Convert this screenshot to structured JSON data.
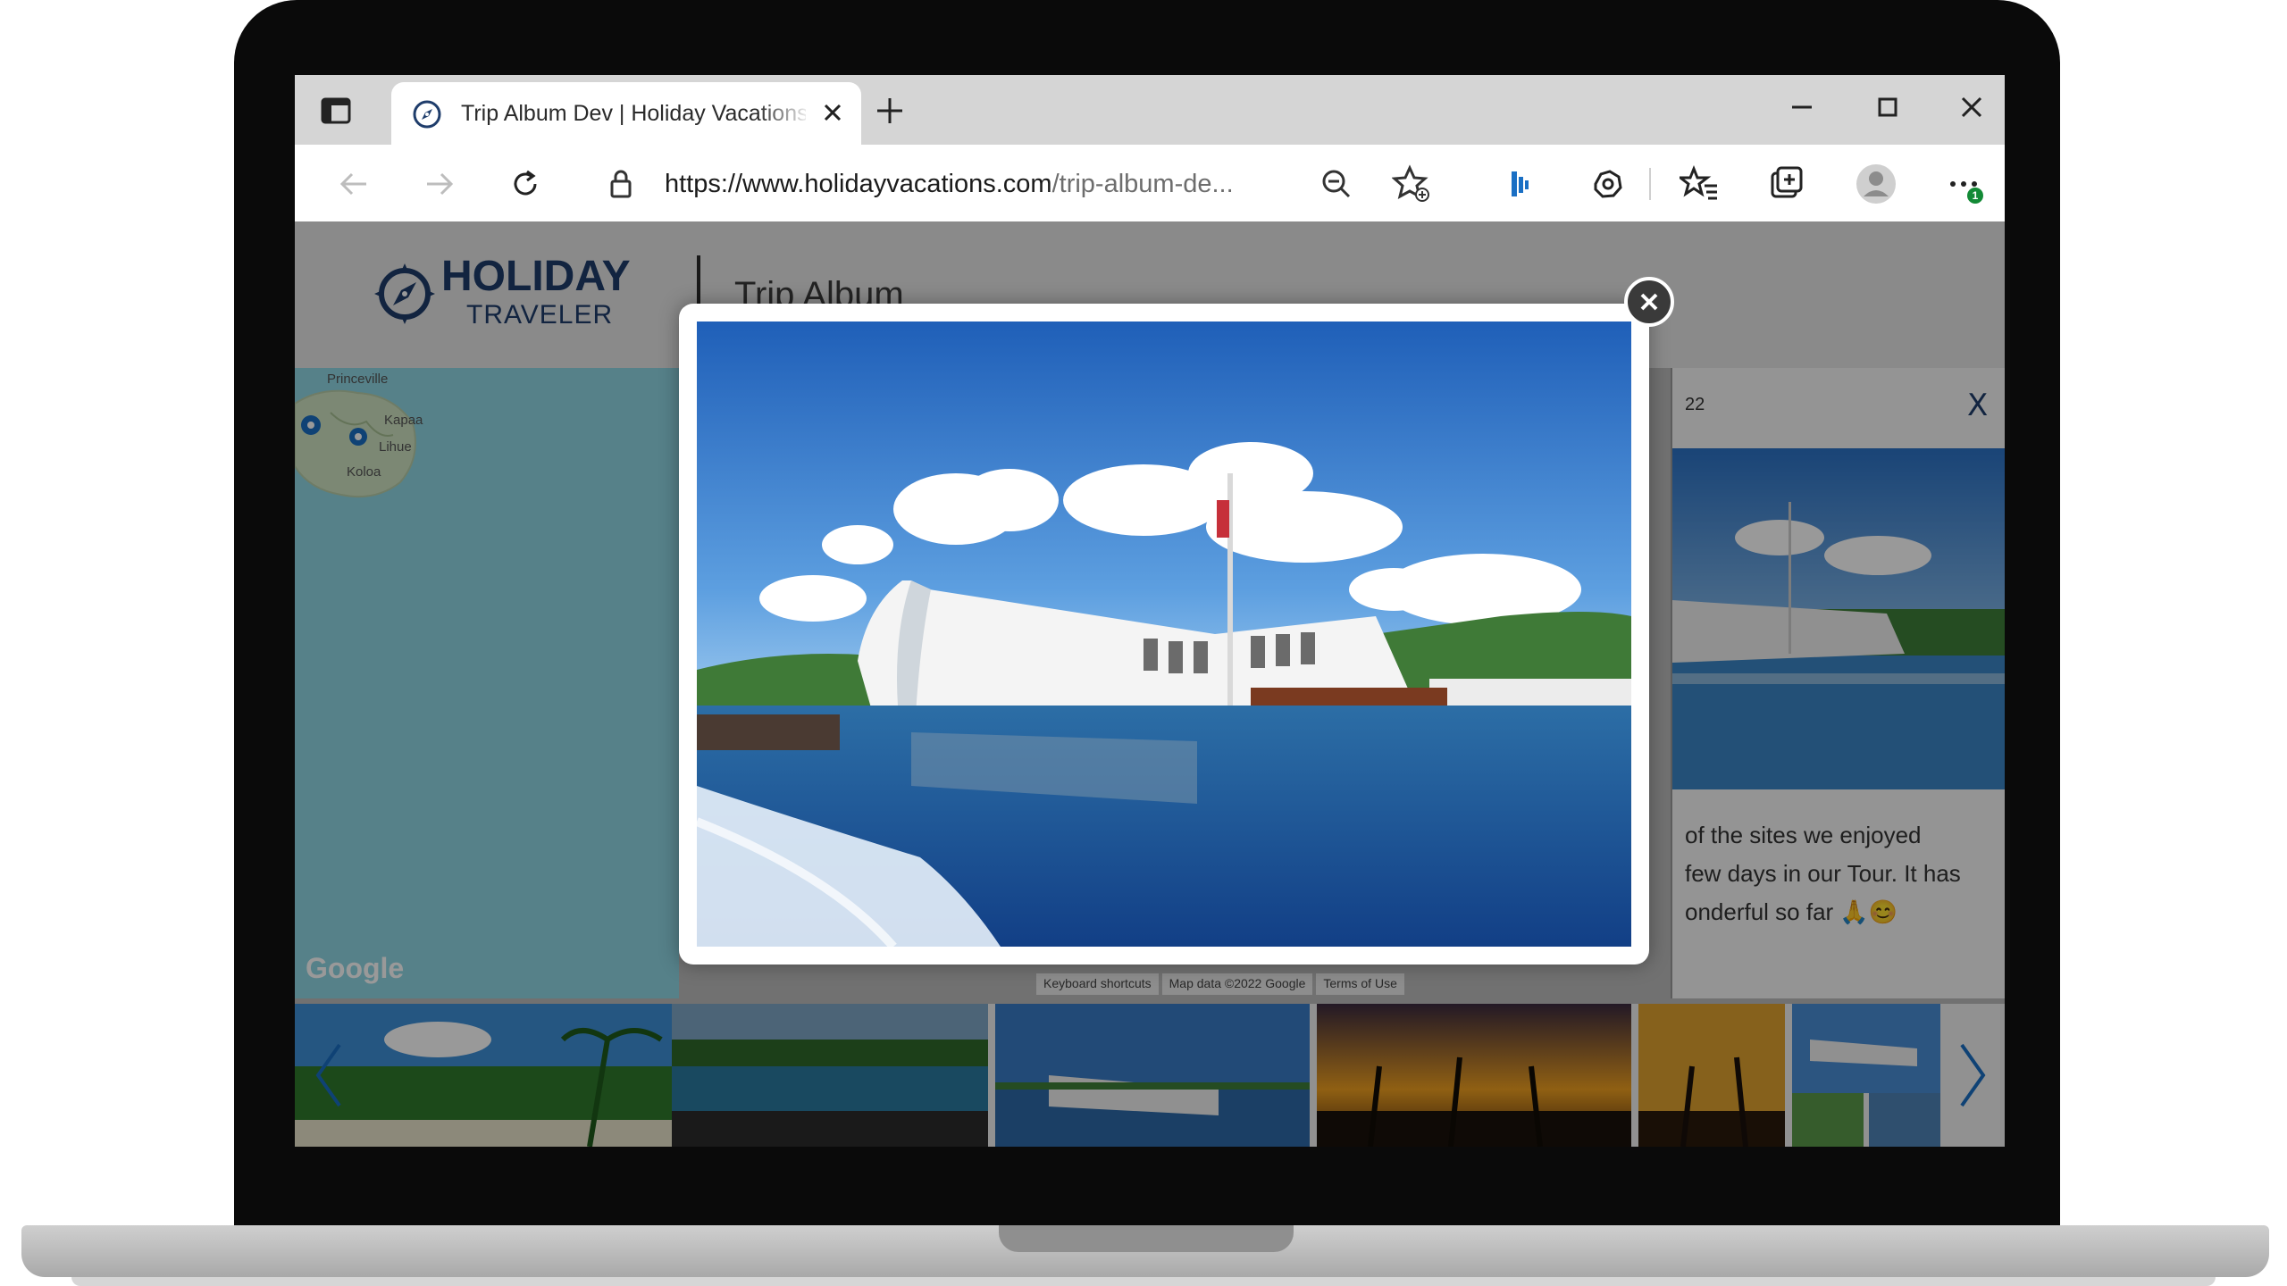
{
  "browser": {
    "tab": {
      "title": "Trip Album Dev | Holiday Vacations"
    },
    "address": {
      "scheme_host": "https://www.holidayvacations.com",
      "path": "/trip-album-de..."
    },
    "notification_count": "1"
  },
  "site": {
    "logo": {
      "line1": "HOLIDAY",
      "line2": "TRAVELER"
    },
    "page_title": "Trip Album"
  },
  "map": {
    "places": [
      "Princeville",
      "Kapaa",
      "Lihue",
      "Koloa"
    ],
    "provider": "Google",
    "attribution": [
      "Keyboard shortcuts",
      "Map data ©2022 Google",
      "Terms of Use"
    ]
  },
  "post": {
    "date": "22",
    "close_label": "X",
    "text_lines": [
      "of the sites we enjoyed",
      "few days in our Tour. It has",
      "onderful so far 🙏😊"
    ]
  },
  "filmstrip": {
    "thumbnails": [
      "tropical-beach",
      "rocky-cove",
      "arizona-memorial",
      "sunset-palms",
      "sunset-palms-2",
      "memorial-collage"
    ]
  },
  "icons": {
    "tab_actions": "tab-actions-icon",
    "favicon": "compass-icon",
    "close": "close-icon",
    "new_tab": "plus-icon",
    "back": "back-arrow-icon",
    "forward": "forward-arrow-icon",
    "refresh": "refresh-icon",
    "lock": "lock-icon",
    "zoom": "zoom-out-icon",
    "favorite": "add-favorite-icon",
    "extensions": "extensions-icon",
    "favorites": "favorites-icon",
    "collections": "collections-icon",
    "profile": "profile-icon",
    "more": "more-icon"
  },
  "colors": {
    "brand": "#1f3d6b",
    "accent": "#1a6fc4",
    "notification": "#138a36"
  }
}
